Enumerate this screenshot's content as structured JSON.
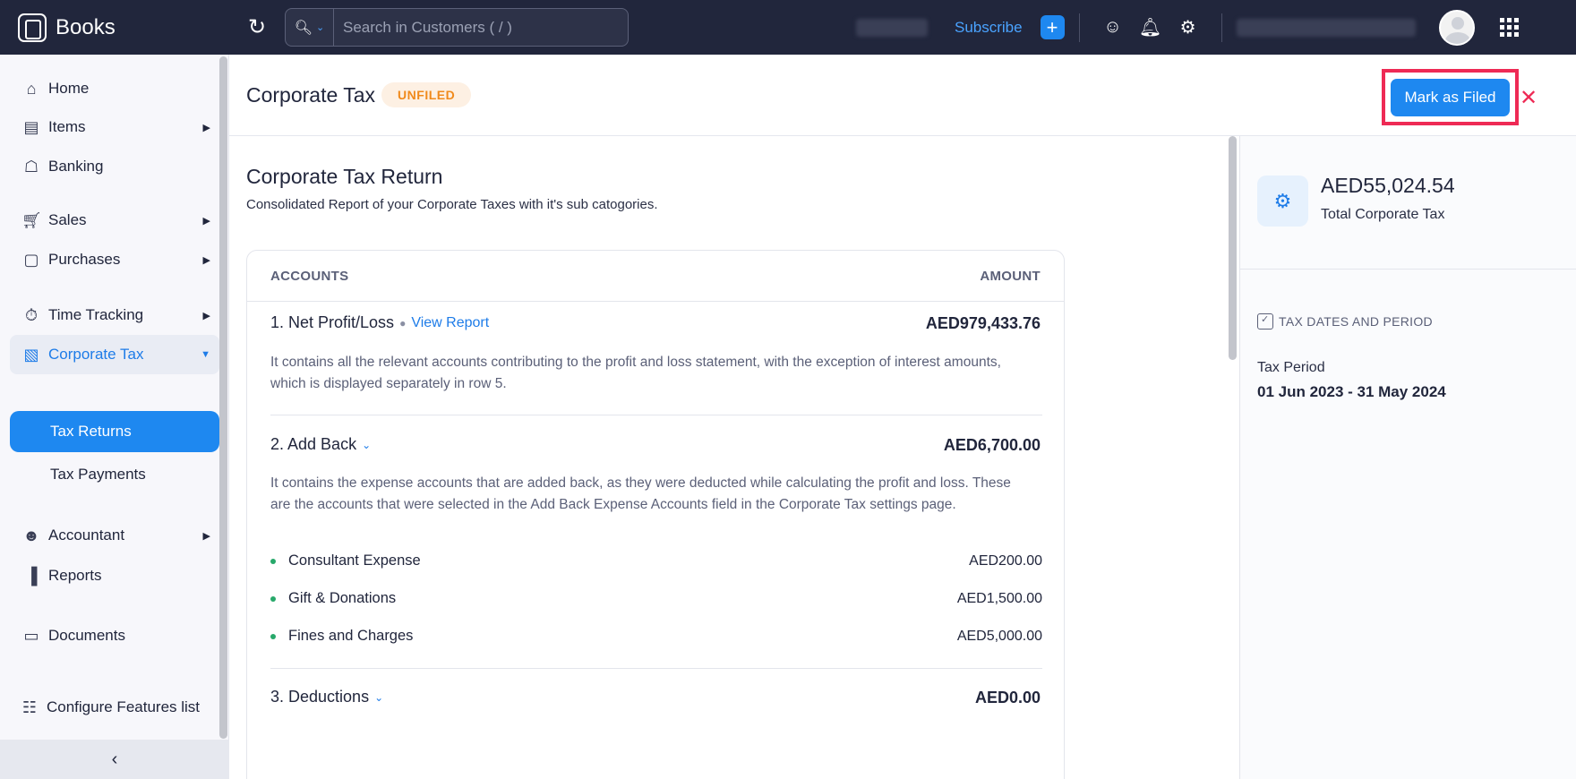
{
  "app": {
    "brand": "Books"
  },
  "topbar": {
    "search_placeholder": "Search in Customers ( / )",
    "subscribe_label": "Subscribe",
    "plus_label": "+"
  },
  "sidebar": {
    "items": [
      {
        "label": "Home",
        "icon": "home-icon"
      },
      {
        "label": "Items",
        "icon": "basket-icon"
      },
      {
        "label": "Banking",
        "icon": "bank-icon"
      },
      {
        "label": "Sales",
        "icon": "cart-icon"
      },
      {
        "label": "Purchases",
        "icon": "bag-icon"
      },
      {
        "label": "Time Tracking",
        "icon": "stopwatch-icon"
      },
      {
        "label": "Corporate Tax",
        "icon": "tax-icon"
      },
      {
        "label": "Accountant",
        "icon": "accountant-icon"
      },
      {
        "label": "Reports",
        "icon": "bar-chart-icon"
      },
      {
        "label": "Documents",
        "icon": "folder-icon"
      },
      {
        "label": "Configure Features list",
        "icon": "toggle-icon"
      }
    ],
    "sub_items": [
      {
        "label": "Tax Returns"
      },
      {
        "label": "Tax Payments"
      }
    ]
  },
  "header": {
    "title": "Corporate Tax",
    "status": "UNFILED",
    "mark_button": "Mark as Filed",
    "close": "✕"
  },
  "main": {
    "title": "Corporate Tax Return",
    "subtitle": "Consolidated Report of your Corporate Taxes with it's sub catogories.",
    "col_accounts": "ACCOUNTS",
    "col_amount": "AMOUNT",
    "rows": [
      {
        "title": "1. Net Profit/Loss",
        "link": "View Report",
        "amount": "AED979,433.76",
        "desc": "It contains all the relevant accounts contributing to the profit and loss statement, with the exception of interest amounts, which is displayed separately in row 5."
      },
      {
        "title": "2. Add Back",
        "amount": "AED6,700.00",
        "desc": "It contains the expense accounts that are added back, as they were deducted while calculating the profit and loss. These are the accounts that were selected in the Add Back Expense Accounts field in the Corporate Tax settings page.",
        "items": [
          {
            "name": "Consultant Expense",
            "amount": "AED200.00"
          },
          {
            "name": "Gift & Donations",
            "amount": "AED1,500.00"
          },
          {
            "name": "Fines and Charges",
            "amount": "AED5,000.00"
          }
        ]
      },
      {
        "title": "3. Deductions",
        "amount": "AED0.00"
      }
    ]
  },
  "right": {
    "total_amount": "AED55,024.54",
    "total_label": "Total Corporate Tax",
    "dates_heading": "TAX DATES AND PERIOD",
    "tax_period_label": "Tax Period",
    "tax_period_value": "01 Jun 2023 - 31 May 2024"
  }
}
